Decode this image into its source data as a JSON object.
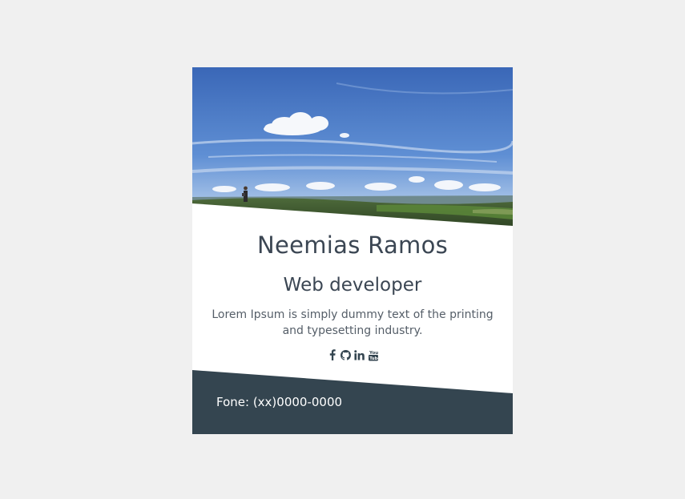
{
  "profile": {
    "name": "Neemias Ramos",
    "role": "Web developer",
    "description": "Lorem Ipsum is simply dummy text of the printing and typesetting industry."
  },
  "social": [
    {
      "icon": "facebook-icon",
      "label": "f"
    },
    {
      "icon": "github-icon",
      "label": ""
    },
    {
      "icon": "linkedin-icon",
      "label": "in"
    },
    {
      "icon": "youtube-icon",
      "label": "You"
    }
  ],
  "footer": {
    "phone": "Fone: (xx)0000-0000"
  },
  "colors": {
    "background": "#f0f0f0",
    "card": "#ffffff",
    "footer": "#344550",
    "text": "#3b4653",
    "sky_top": "#3f6fbf",
    "sky_bottom": "#a9c3e6"
  }
}
